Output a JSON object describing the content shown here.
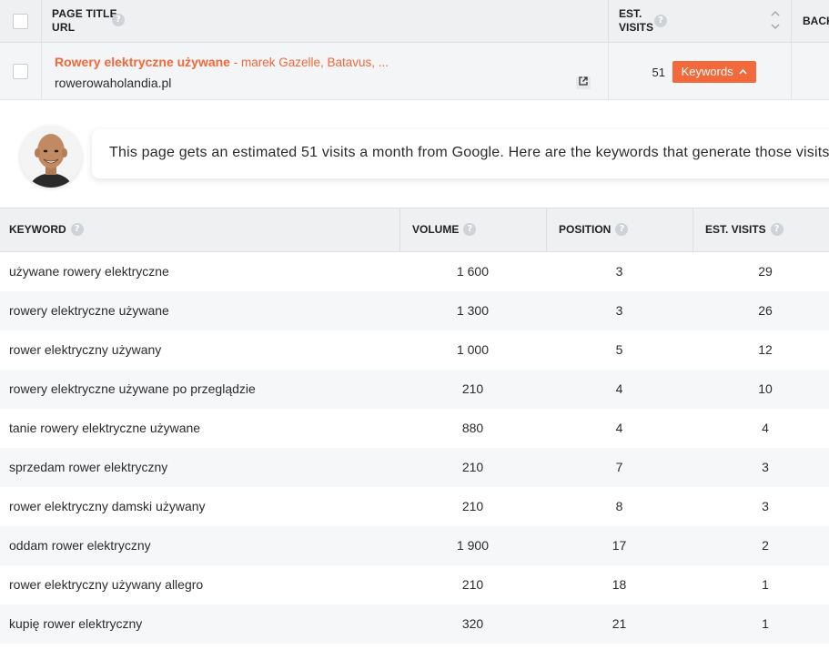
{
  "top_table": {
    "header": {
      "title_label_line1": "PAGE TITLE",
      "title_label_line2": "URL",
      "visits_label_line1": "EST.",
      "visits_label_line2": "VISITS",
      "backlinks_label": "BACK"
    },
    "row": {
      "title": "Rowery elektryczne używane",
      "title_suffix": " - marek Gazelle, Batavus, ...",
      "url": "rowerowaholandia.pl",
      "visits": "51",
      "keywords_button": "Keywords"
    }
  },
  "assistant": {
    "message": "This page gets an estimated 51 visits a month from Google. Here are the keywords that generate those visits:"
  },
  "keywords_table": {
    "columns": {
      "keyword": "KEYWORD",
      "volume": "VOLUME",
      "position": "POSITION",
      "visits": "EST. VISITS"
    },
    "rows": [
      {
        "keyword": "używane rowery elektryczne",
        "volume": "1 600",
        "position": "3",
        "visits": "29"
      },
      {
        "keyword": "rowery elektryczne używane",
        "volume": "1 300",
        "position": "3",
        "visits": "26"
      },
      {
        "keyword": "rower elektryczny używany",
        "volume": "1 000",
        "position": "5",
        "visits": "12"
      },
      {
        "keyword": "rowery elektryczne używane po przeglądzie",
        "volume": "210",
        "position": "4",
        "visits": "10"
      },
      {
        "keyword": "tanie rowery elektryczne używane",
        "volume": "880",
        "position": "4",
        "visits": "4"
      },
      {
        "keyword": "sprzedam rower elektryczny",
        "volume": "210",
        "position": "7",
        "visits": "3"
      },
      {
        "keyword": "rower elektryczny damski używany",
        "volume": "210",
        "position": "8",
        "visits": "3"
      },
      {
        "keyword": "oddam rower elektryczny",
        "volume": "1 900",
        "position": "17",
        "visits": "2"
      },
      {
        "keyword": "rower elektryczny używany allegro",
        "volume": "210",
        "position": "18",
        "visits": "1"
      },
      {
        "keyword": "kupię rower elektryczny",
        "volume": "320",
        "position": "21",
        "visits": "1"
      }
    ]
  },
  "icons": {
    "help": "help-circle-icon",
    "external_link": "external-link-icon",
    "sort": "sort-arrows-icon",
    "chevron_up": "chevron-up-icon"
  },
  "colors": {
    "accent": "#f26a3b",
    "header_bg": "#eef0f2",
    "stripe_bg": "#f6f7f8"
  }
}
